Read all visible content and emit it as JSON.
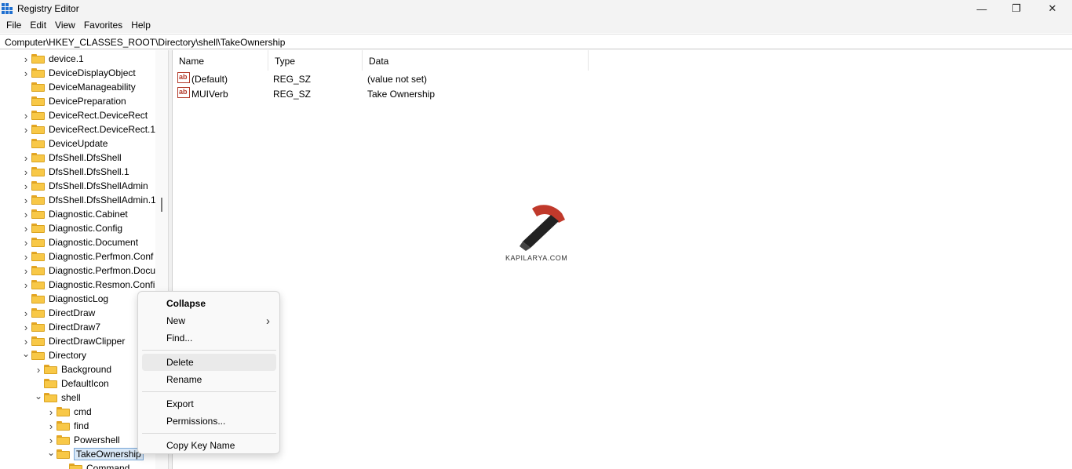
{
  "window": {
    "title": "Registry Editor",
    "minimize_glyph": "—",
    "maximize_glyph": "❐",
    "close_glyph": "✕"
  },
  "menu": [
    "File",
    "Edit",
    "View",
    "Favorites",
    "Help"
  ],
  "address": "Computer\\HKEY_CLASSES_ROOT\\Directory\\shell\\TakeOwnership",
  "tree": [
    {
      "label": "device.1",
      "level": 0,
      "expander": "collapsed"
    },
    {
      "label": "DeviceDisplayObject",
      "level": 0,
      "expander": "collapsed"
    },
    {
      "label": "DeviceManageability",
      "level": 0,
      "expander": "none"
    },
    {
      "label": "DevicePreparation",
      "level": 0,
      "expander": "none"
    },
    {
      "label": "DeviceRect.DeviceRect",
      "level": 0,
      "expander": "collapsed"
    },
    {
      "label": "DeviceRect.DeviceRect.1",
      "level": 0,
      "expander": "collapsed"
    },
    {
      "label": "DeviceUpdate",
      "level": 0,
      "expander": "none"
    },
    {
      "label": "DfsShell.DfsShell",
      "level": 0,
      "expander": "collapsed"
    },
    {
      "label": "DfsShell.DfsShell.1",
      "level": 0,
      "expander": "collapsed"
    },
    {
      "label": "DfsShell.DfsShellAdmin",
      "level": 0,
      "expander": "collapsed"
    },
    {
      "label": "DfsShell.DfsShellAdmin.1",
      "level": 0,
      "expander": "collapsed"
    },
    {
      "label": "Diagnostic.Cabinet",
      "level": 0,
      "expander": "collapsed"
    },
    {
      "label": "Diagnostic.Config",
      "level": 0,
      "expander": "collapsed"
    },
    {
      "label": "Diagnostic.Document",
      "level": 0,
      "expander": "collapsed"
    },
    {
      "label": "Diagnostic.Perfmon.Conf",
      "level": 0,
      "expander": "collapsed"
    },
    {
      "label": "Diagnostic.Perfmon.Docu",
      "level": 0,
      "expander": "collapsed"
    },
    {
      "label": "Diagnostic.Resmon.Confi",
      "level": 0,
      "expander": "collapsed"
    },
    {
      "label": "DiagnosticLog",
      "level": 0,
      "expander": "none"
    },
    {
      "label": "DirectDraw",
      "level": 0,
      "expander": "collapsed"
    },
    {
      "label": "DirectDraw7",
      "level": 0,
      "expander": "collapsed"
    },
    {
      "label": "DirectDrawClipper",
      "level": 0,
      "expander": "collapsed"
    },
    {
      "label": "Directory",
      "level": 0,
      "expander": "expanded"
    },
    {
      "label": "Background",
      "level": 1,
      "expander": "collapsed"
    },
    {
      "label": "DefaultIcon",
      "level": 1,
      "expander": "none"
    },
    {
      "label": "shell",
      "level": 1,
      "expander": "expanded"
    },
    {
      "label": "cmd",
      "level": 2,
      "expander": "collapsed"
    },
    {
      "label": "find",
      "level": 2,
      "expander": "collapsed"
    },
    {
      "label": "Powershell",
      "level": 2,
      "expander": "collapsed"
    },
    {
      "label": "TakeOwnership",
      "level": 2,
      "expander": "expanded",
      "selected": true
    },
    {
      "label": "Command",
      "level": 3,
      "expander": "none"
    }
  ],
  "list": {
    "columns": [
      "Name",
      "Type",
      "Data"
    ],
    "rows": [
      {
        "icon": "ab",
        "name": "(Default)",
        "type": "REG_SZ",
        "data": "(value not set)"
      },
      {
        "icon": "ab",
        "name": "MUIVerb",
        "type": "REG_SZ",
        "data": "Take Ownership"
      }
    ]
  },
  "watermark": {
    "text": "KAPILARYA.COM",
    "icon": "hammer-icon"
  },
  "context_menu": {
    "items": [
      {
        "label": "Collapse",
        "bold": true
      },
      {
        "label": "New",
        "submenu": true
      },
      {
        "label": "Find..."
      },
      {
        "separator": true
      },
      {
        "label": "Delete",
        "highlighted": true
      },
      {
        "label": "Rename"
      },
      {
        "separator": true
      },
      {
        "label": "Export"
      },
      {
        "label": "Permissions..."
      },
      {
        "separator": true
      },
      {
        "label": "Copy Key Name"
      }
    ],
    "submenu_arrow": "›"
  },
  "colors": {
    "folder": "#f8c847",
    "selection": "#d9e8f7",
    "menu_hover": "#eaeaea",
    "app_icon": "#1e6fd0",
    "watermark_hammer": "#c0392b"
  }
}
